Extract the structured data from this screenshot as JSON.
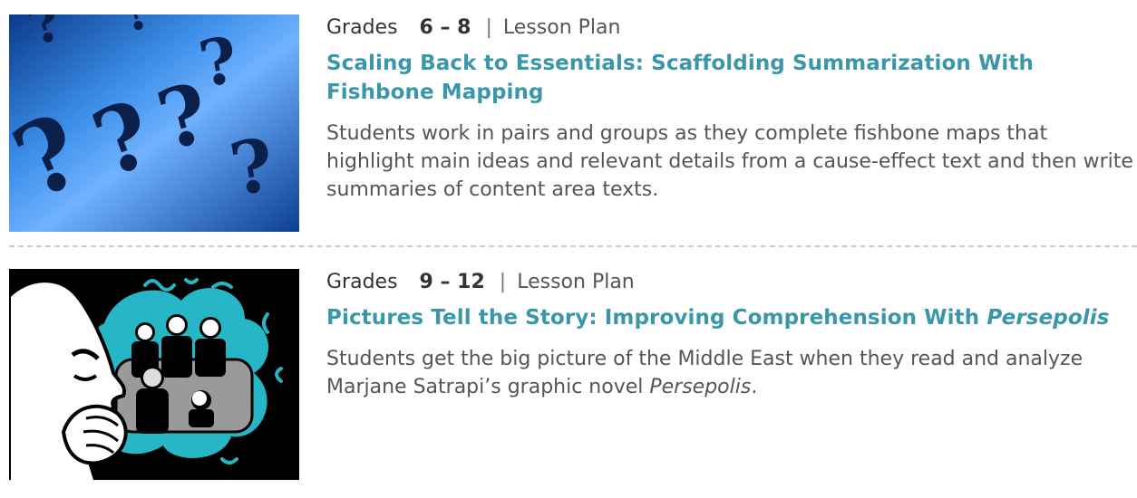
{
  "lessons": [
    {
      "grades_label": "Grades",
      "grades_range": "6 – 8",
      "separator": "|",
      "type": "Lesson Plan",
      "title": "Scaling Back to Essentials: Scaffolding Summarization With Fishbone Mapping",
      "description": "Students work in pairs and groups as they complete fishbone maps that highlight main ideas and relevant details from a cause-effect text and then write summaries of content area texts.",
      "image": "question-marks-image"
    },
    {
      "grades_label": "Grades",
      "grades_range": "9 – 12",
      "separator": "|",
      "type": "Lesson Plan",
      "title_main": "Pictures Tell the Story: Improving Comprehension With ",
      "title_italic": "Persepolis",
      "description_main": "Students get the big picture of the Middle East when they read and analyze Marjane Satrapi’s graphic novel ",
      "description_italic": "Persepolis",
      "description_end": ".",
      "image": "persepolis-illustration-image"
    }
  ],
  "colors": {
    "title_link": "#3a97a9",
    "body_text": "#555555",
    "divider": "#cccccc"
  }
}
